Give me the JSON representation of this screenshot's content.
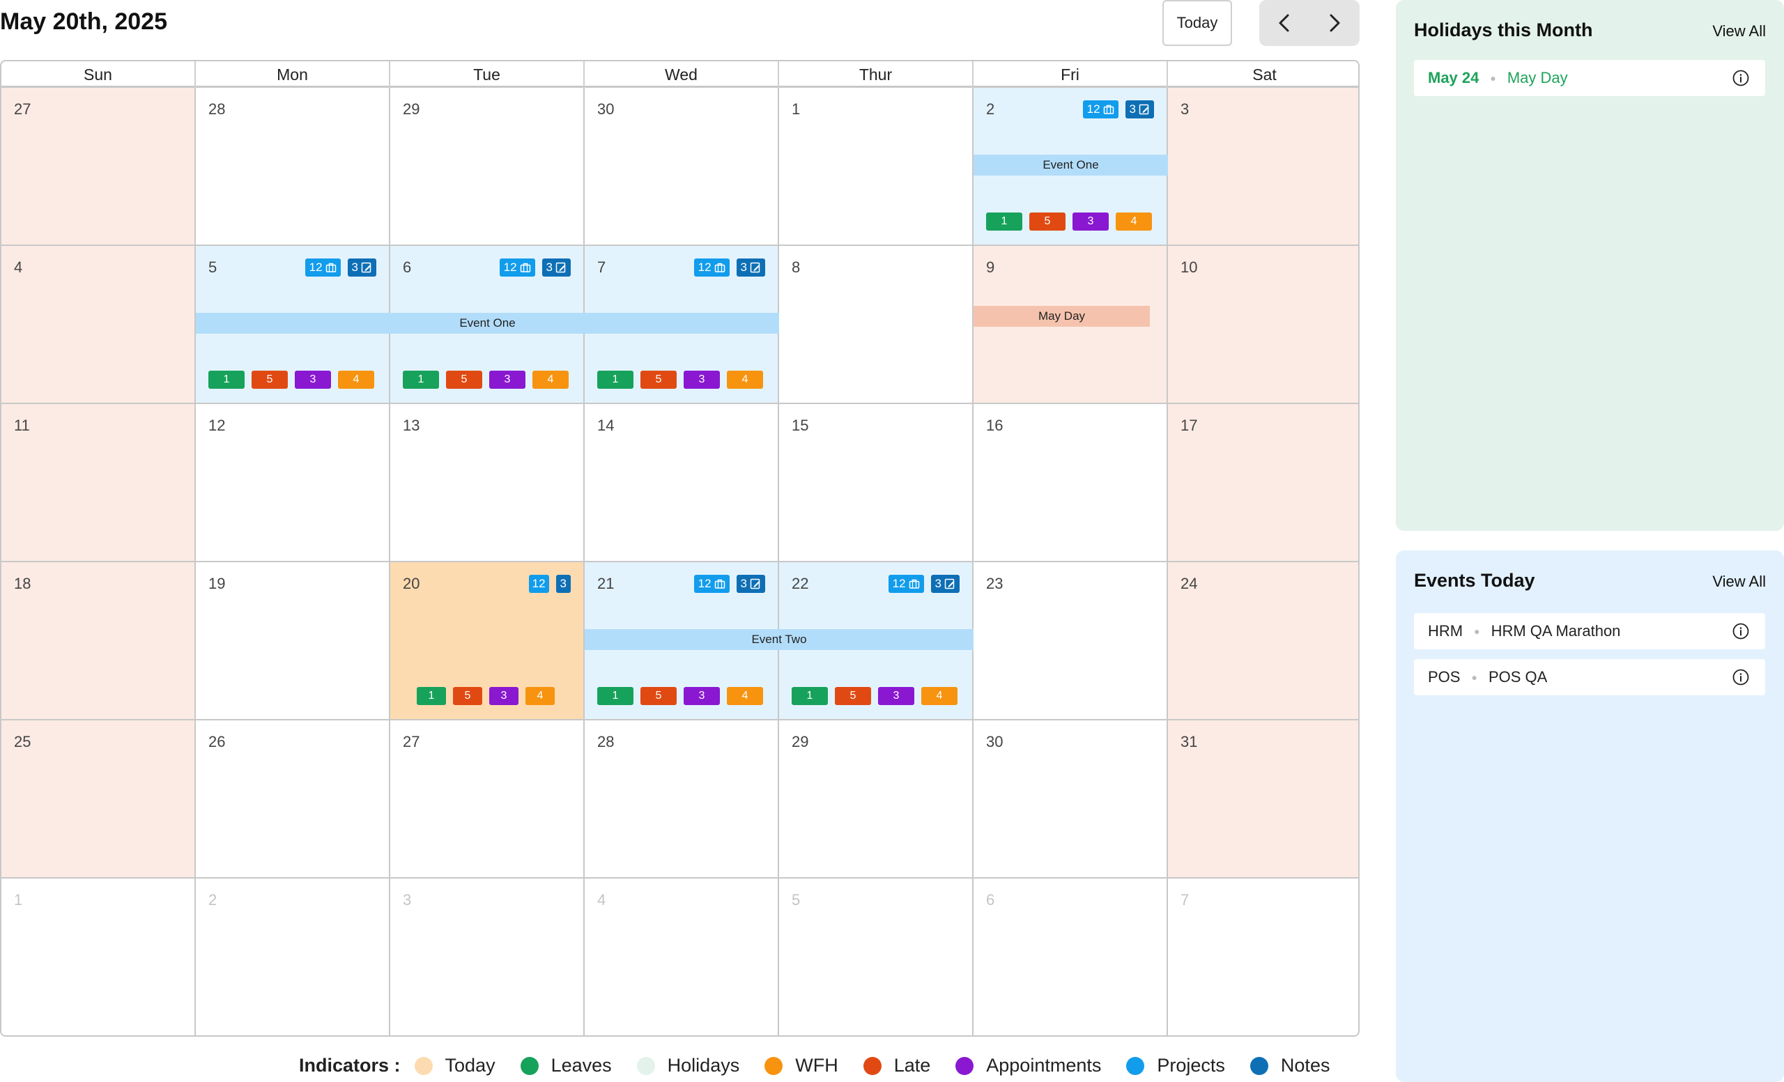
{
  "header": {
    "title": "May 20th, 2025",
    "today_label": "Today",
    "prev_icon": "chevron-left-icon",
    "next_icon": "chevron-right-icon"
  },
  "calendar": {
    "weekdays": [
      "Sun",
      "Mon",
      "Tue",
      "Wed",
      "Thur",
      "Fri",
      "Sat"
    ],
    "weeks": [
      [
        {
          "day": "27",
          "type": "weekend"
        },
        {
          "day": "28",
          "type": "normal"
        },
        {
          "day": "29",
          "type": "normal"
        },
        {
          "day": "30",
          "type": "normal"
        },
        {
          "day": "1",
          "type": "normal"
        },
        {
          "day": "2",
          "type": "event",
          "projects": "12",
          "notes": "3",
          "indicators": [
            "1",
            "5",
            "3",
            "4"
          ]
        },
        {
          "day": "3",
          "type": "weekend"
        }
      ],
      [
        {
          "day": "4",
          "type": "weekend"
        },
        {
          "day": "5",
          "type": "event",
          "projects": "12",
          "notes": "3",
          "indicators": [
            "1",
            "5",
            "3",
            "4"
          ]
        },
        {
          "day": "6",
          "type": "event",
          "projects": "12",
          "notes": "3",
          "indicators": [
            "1",
            "5",
            "3",
            "4"
          ]
        },
        {
          "day": "7",
          "type": "event",
          "projects": "12",
          "notes": "3",
          "indicators": [
            "1",
            "5",
            "3",
            "4"
          ]
        },
        {
          "day": "8",
          "type": "normal"
        },
        {
          "day": "9",
          "type": "holiday"
        },
        {
          "day": "10",
          "type": "weekend"
        }
      ],
      [
        {
          "day": "11",
          "type": "weekend"
        },
        {
          "day": "12",
          "type": "normal"
        },
        {
          "day": "13",
          "type": "normal"
        },
        {
          "day": "14",
          "type": "normal"
        },
        {
          "day": "15",
          "type": "normal"
        },
        {
          "day": "16",
          "type": "normal"
        },
        {
          "day": "17",
          "type": "weekend"
        }
      ],
      [
        {
          "day": "18",
          "type": "weekend"
        },
        {
          "day": "19",
          "type": "normal"
        },
        {
          "day": "20",
          "type": "today",
          "projects": "12",
          "notes": "3",
          "indicators": [
            "1",
            "5",
            "3",
            "4"
          ]
        },
        {
          "day": "21",
          "type": "event",
          "projects": "12",
          "notes": "3",
          "indicators": [
            "1",
            "5",
            "3",
            "4"
          ]
        },
        {
          "day": "22",
          "type": "event",
          "projects": "12",
          "notes": "3",
          "indicators": [
            "1",
            "5",
            "3",
            "4"
          ]
        },
        {
          "day": "23",
          "type": "normal"
        },
        {
          "day": "24",
          "type": "weekend"
        }
      ],
      [
        {
          "day": "25",
          "type": "weekend"
        },
        {
          "day": "26",
          "type": "normal"
        },
        {
          "day": "27",
          "type": "normal"
        },
        {
          "day": "28",
          "type": "normal"
        },
        {
          "day": "29",
          "type": "normal"
        },
        {
          "day": "30",
          "type": "normal"
        },
        {
          "day": "31",
          "type": "weekend"
        }
      ],
      [
        {
          "day": "1",
          "type": "other"
        },
        {
          "day": "2",
          "type": "other"
        },
        {
          "day": "3",
          "type": "other"
        },
        {
          "day": "4",
          "type": "other"
        },
        {
          "day": "5",
          "type": "other"
        },
        {
          "day": "6",
          "type": "other"
        },
        {
          "day": "7",
          "type": "other"
        }
      ]
    ],
    "bars": [
      {
        "label": "Event One",
        "kind": "event",
        "week": 0,
        "start": 5,
        "end": 5
      },
      {
        "label": "Event One",
        "kind": "event",
        "week": 1,
        "start": 1,
        "end": 3
      },
      {
        "label": "May Day",
        "kind": "holiday",
        "week": 1,
        "start": 5,
        "end": 5
      },
      {
        "label": "Event Two",
        "kind": "event",
        "week": 3,
        "start": 3,
        "end": 4
      }
    ]
  },
  "legend": {
    "title": "Indicators :",
    "items": [
      {
        "label": "Today",
        "color": "#fddbb0"
      },
      {
        "label": "Leaves",
        "color": "#17a25b"
      },
      {
        "label": "Holidays",
        "color": "#e3f2ea"
      },
      {
        "label": "WFH",
        "color": "#f7930f"
      },
      {
        "label": "Late",
        "color": "#e04a12"
      },
      {
        "label": "Appointments",
        "color": "#8a18d1"
      },
      {
        "label": "Projects",
        "color": "#129cec"
      },
      {
        "label": "Notes",
        "color": "#0e6fb5"
      }
    ]
  },
  "holidays_panel": {
    "title": "Holidays this Month",
    "view_all": "View All",
    "items": [
      {
        "date": "May 24",
        "name": "May Day"
      }
    ]
  },
  "events_panel": {
    "title": "Events Today",
    "view_all": "View All",
    "items": [
      {
        "category": "HRM",
        "name": "HRM QA Marathon"
      },
      {
        "category": "POS",
        "name": "POS QA"
      }
    ]
  }
}
